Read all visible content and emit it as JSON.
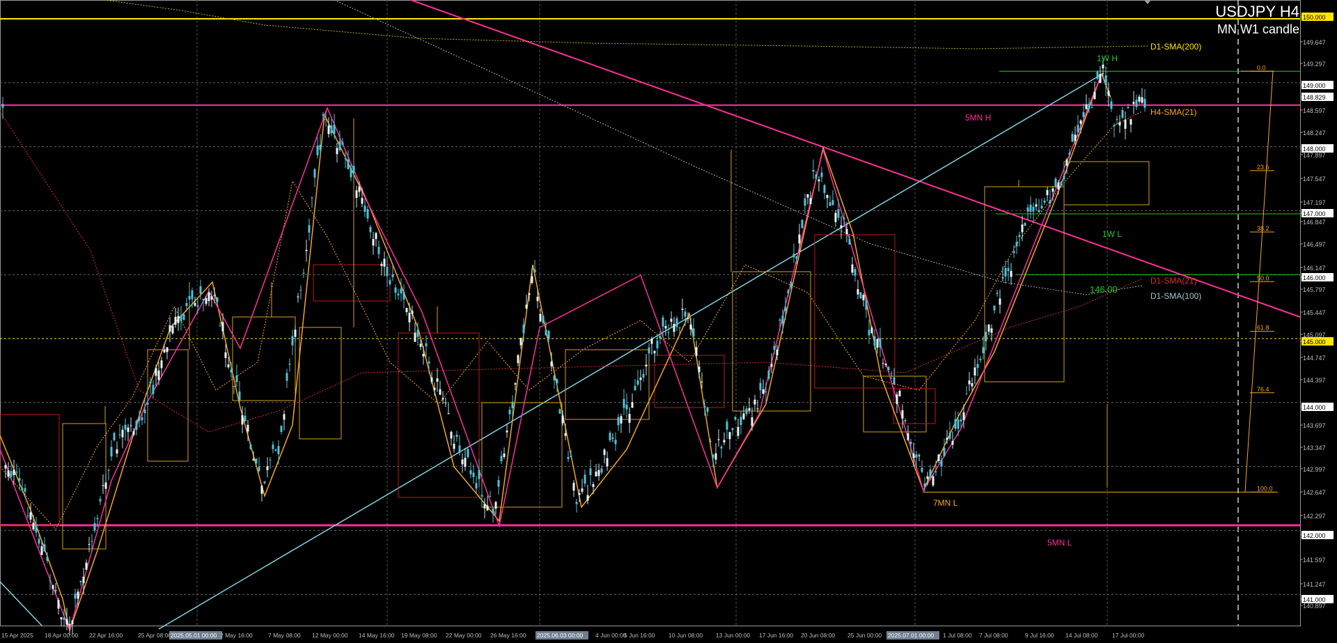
{
  "window": {
    "symbol_title": "USDJPY H4",
    "mode_label": "MN W1 candle"
  },
  "colors": {
    "background": "#000000",
    "grid": "#6a6a6a",
    "axis": "#9a9a9a",
    "candle": "#4fc3d9",
    "magenta": "#ff2f9a",
    "orange": "#f5a623",
    "yellow": "#ffe600",
    "green": "#22cc22",
    "cyan_trend": "#7fd3e0",
    "red_box": "#c01818",
    "tan_box": "#d8a020"
  },
  "price_axis": {
    "ticks": [
      "150.000",
      "149.647",
      "149.297",
      "149.000",
      "148.829",
      "148.597",
      "148.247",
      "148.000",
      "147.897",
      "147.547",
      "147.197",
      "147.000",
      "146.847",
      "146.497",
      "146.147",
      "146.000",
      "145.797",
      "145.447",
      "145.097",
      "145.000",
      "144.747",
      "144.397",
      "144.000",
      "143.697",
      "143.347",
      "142.997",
      "142.647",
      "142.297",
      "142.000",
      "141.597",
      "141.247",
      "141.000",
      "140.897"
    ],
    "highlighted": [
      {
        "label": "150.000",
        "style": "yellow"
      },
      {
        "label": "149.000",
        "style": "white"
      },
      {
        "label": "148.829",
        "style": "white"
      },
      {
        "label": "148.000",
        "style": "white"
      },
      {
        "label": "147.000",
        "style": "white"
      },
      {
        "label": "146.000",
        "style": "white"
      },
      {
        "label": "145.000",
        "style": "yellow"
      },
      {
        "label": "144.000",
        "style": "white"
      },
      {
        "label": "143.000",
        "style": "white"
      },
      {
        "label": "142.000",
        "style": "white"
      },
      {
        "label": "141.000",
        "style": "white"
      }
    ]
  },
  "time_axis": {
    "labels": [
      "15 Apr 2025",
      "18 Apr 00:00",
      "22 Apr 16:00",
      "25 Apr 08:00",
      "2025.05.01 00:00",
      "2 May 16:00",
      "7 May 08:00",
      "12 May 00:00",
      "14 May 16:00",
      "19 May 08:00",
      "22 May 00:00",
      "26 May 16:00",
      "2025.06.03 00:00",
      "4 Jun 00:00",
      "5 Jun 16:00",
      "10 Jun 08:00",
      "13 Jun 00:00",
      "17 Jun 16:00",
      "20 Jun 08:00",
      "25 Jun 00:00",
      "2025.07.01 00:00",
      "1 Jul 08:00",
      "7 Jul 08:00",
      "9 Jul 16:00",
      "14 Jul 08:00",
      "17 Jul 00:00"
    ]
  },
  "annotations": {
    "w1_high": "1W H",
    "w1_low": "1W L",
    "mn5_high": "5MN H",
    "mn5_low": "5MN L",
    "mn7_low": "7MN L",
    "sma200": "D1-SMA(200)",
    "sma21_h4": "H4-SMA(21)",
    "sma21_d1": "D1-SMA(21)",
    "sma100": "D1-SMA(100)",
    "level_146": "146.00"
  },
  "fibonacci": [
    "0.0",
    "23.6",
    "38.2",
    "50.0",
    "61.8",
    "76.4",
    "100.0"
  ],
  "chart_data": {
    "type": "candlestick",
    "title": "USDJPY H4",
    "ylim": [
      140.85,
      150.15
    ],
    "horizontal_levels": [
      150.0,
      149.0,
      148.0,
      147.0,
      146.0,
      145.0,
      144.0,
      143.0,
      142.0,
      141.0
    ],
    "swing_points": [
      {
        "label": "5MN H",
        "price": 148.65
      },
      {
        "label": "1W H",
        "price": 149.18
      },
      {
        "label": "7MN L",
        "price": 142.6
      },
      {
        "label": "5MN L",
        "price": 142.08
      }
    ]
  }
}
